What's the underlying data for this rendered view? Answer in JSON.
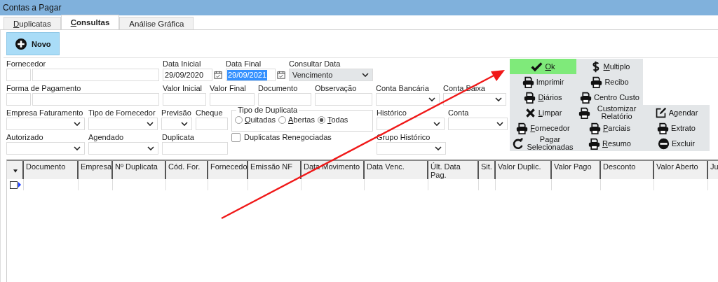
{
  "window": {
    "title": "Contas a Pagar"
  },
  "tabs": [
    {
      "label": "Duplicatas",
      "selected": false,
      "mnemonic": true
    },
    {
      "label": "Consultas",
      "selected": true,
      "mnemonic": true
    },
    {
      "label": "Análise Gráfica",
      "selected": false,
      "mnemonic": false
    }
  ],
  "toolbar": {
    "new_button": "Novo"
  },
  "form_rows": [
    [
      {
        "kind": "double-text",
        "label": "Fornecedor"
      },
      {
        "kind": "date",
        "label": "Data Inicial",
        "value": "29/09/2020",
        "focused": false
      },
      {
        "kind": "date",
        "label": "Data Final",
        "value": "29/09/2021",
        "focused": true
      },
      {
        "kind": "combo",
        "label": "Consultar Data",
        "value": "Vencimento"
      }
    ],
    [
      {
        "kind": "double-text",
        "label": "Forma de Pagamento"
      },
      {
        "kind": "text",
        "label": "Valor Inicial"
      },
      {
        "kind": "text",
        "label": "Valor Final"
      },
      {
        "kind": "text",
        "label": "Documento"
      },
      {
        "kind": "text",
        "label": "Observação"
      },
      {
        "kind": "combo",
        "label": "Conta Bancária"
      },
      {
        "kind": "combo",
        "label": "Conta Baixa"
      }
    ],
    [
      {
        "kind": "combo",
        "label": "Empresa Faturamento"
      },
      {
        "kind": "combo",
        "label": "Tipo de Fornecedor"
      },
      {
        "kind": "combo",
        "label": "Previsão"
      },
      {
        "kind": "text",
        "label": "Cheque"
      },
      {
        "kind": "radio-group",
        "label": "Tipo de Duplicata",
        "options": [
          {
            "label": "Quitadas",
            "selected": false
          },
          {
            "label": "Abertas",
            "selected": false
          },
          {
            "label": "Todas",
            "selected": true
          }
        ]
      },
      {
        "kind": "combo",
        "label": "Histórico"
      },
      {
        "kind": "combo",
        "label": "Conta"
      }
    ],
    [
      {
        "kind": "combo",
        "label": "Autorizado"
      },
      {
        "kind": "combo",
        "label": "Agendado"
      },
      {
        "kind": "text",
        "label": "Duplicata"
      },
      {
        "kind": "checkbox",
        "label": "Duplicatas Renegociadas",
        "checked": false
      },
      {
        "kind": "combo",
        "label": "Grupo Histórico"
      }
    ]
  ],
  "action_rows": [
    [
      {
        "label": "Ok",
        "kind": "check",
        "default": true,
        "mnemonic": true
      },
      {
        "label": "Multiplo",
        "kind": "dollar",
        "default": false,
        "mnemonic": true
      }
    ],
    [
      {
        "label": "Imprimir",
        "kind": "printer",
        "default": false,
        "mnemonic": false
      },
      {
        "label": "Recibo",
        "kind": "printer",
        "default": false,
        "mnemonic": false
      }
    ],
    [
      {
        "label": "Diários",
        "kind": "printer",
        "default": false,
        "mnemonic": true
      },
      {
        "label": "Centro Custo",
        "kind": "printer",
        "default": false,
        "mnemonic": false
      }
    ],
    [
      {
        "label": "Limpar",
        "kind": "cross",
        "default": false,
        "mnemonic": true
      },
      {
        "label": "Customizar Relatório",
        "kind": "printer",
        "default": false,
        "mnemonic": false
      },
      {
        "label": "Agendar",
        "kind": "edit",
        "default": false,
        "mnemonic": false
      }
    ],
    [
      {
        "label": "Fornecedor",
        "kind": "printer",
        "default": false,
        "mnemonic": true
      },
      {
        "label": "Parciais",
        "kind": "printer",
        "default": false,
        "mnemonic": true
      },
      {
        "label": "Extrato",
        "kind": "printer",
        "default": false,
        "mnemonic": false
      }
    ],
    [
      {
        "label": "Pagar Selecionadas",
        "kind": "refresh",
        "default": false,
        "mnemonic": false
      },
      {
        "label": "Resumo",
        "kind": "printer",
        "default": false,
        "mnemonic": true
      },
      {
        "label": "Excluir",
        "kind": "minus",
        "default": false,
        "mnemonic": false
      }
    ]
  ],
  "grid": {
    "columns": [
      "Documento",
      "Empresa",
      "Nº Duplicata",
      "Cód. For.",
      "Fornecedo",
      "Emissão NF",
      "Data Movimento",
      "Data Venc.",
      "Últ. Data Pag.",
      "Sit.",
      "Valor Duplic.",
      "Valor Pago",
      "Desconto",
      "Valor Aberto",
      "Ju"
    ],
    "row": {
      "checked": false
    }
  }
}
